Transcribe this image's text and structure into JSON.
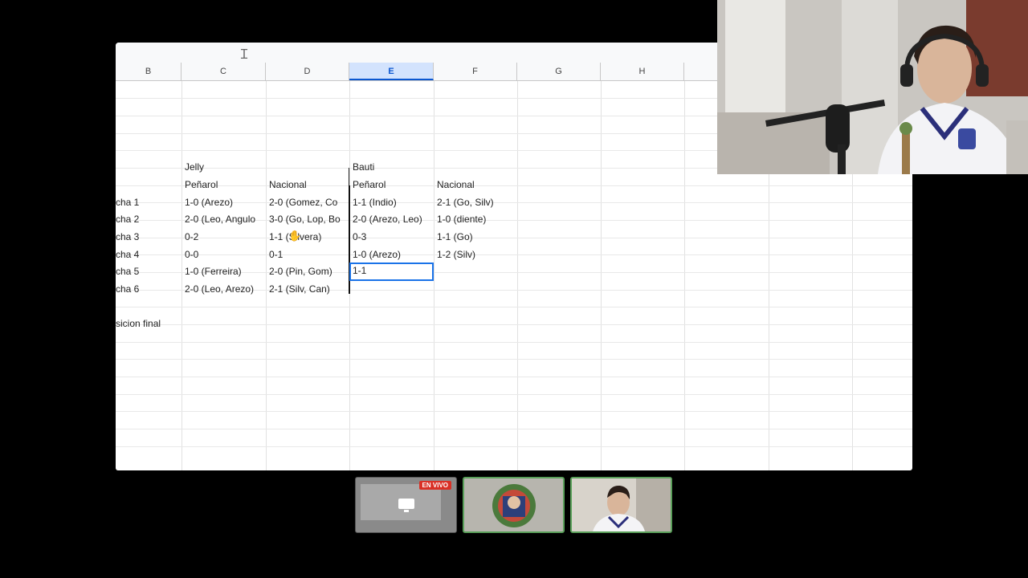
{
  "columns": [
    "B",
    "C",
    "D",
    "E",
    "F",
    "G",
    "H"
  ],
  "selected_column": "E",
  "cells": {
    "c_name_jelly": "Jelly",
    "e_name_bauti": "Bauti",
    "c_team1": "Peñarol",
    "d_team2": "Nacional",
    "e_team1": "Peñarol",
    "f_team2": "Nacional",
    "rows": [
      {
        "b": "cha 1",
        "c": "1-0 (Arezo)",
        "d": "2-0 (Gomez, Co",
        "e": "1-1 (Indio)",
        "f": "2-1 (Go, Silv)"
      },
      {
        "b": "cha 2",
        "c": "2-0 (Leo, Angulo",
        "d": "3-0 (Go, Lop, Bo",
        "e": "2-0 (Arezo, Leo)",
        "f": "1-0 (diente)"
      },
      {
        "b": "cha 3",
        "c": "0-2",
        "d": "1-1 (Silvera)",
        "e": "0-3",
        "f": "1-1 (Go)"
      },
      {
        "b": "cha 4",
        "c": "0-0",
        "d": "0-1",
        "e": "1-0 (Arezo)",
        "f": "1-2 (Silv)"
      },
      {
        "b": "cha 5",
        "c": "1-0 (Ferreira)",
        "d": "2-0 (Pin, Gom)",
        "e": "1-1",
        "f": ""
      },
      {
        "b": "cha 6",
        "c": "2-0 (Leo, Arezo)",
        "d": "2-1 (Silv, Can)",
        "e": "",
        "f": ""
      }
    ],
    "b_final": "sicion final"
  },
  "live_badge": "EN VIVO",
  "colors": {
    "selection_blue": "#1a73e8",
    "header_bg": "#f8f9fa",
    "selected_header_bg": "#d3e3fd",
    "live_red": "#d93025",
    "active_tile_border": "#5aa05a"
  }
}
